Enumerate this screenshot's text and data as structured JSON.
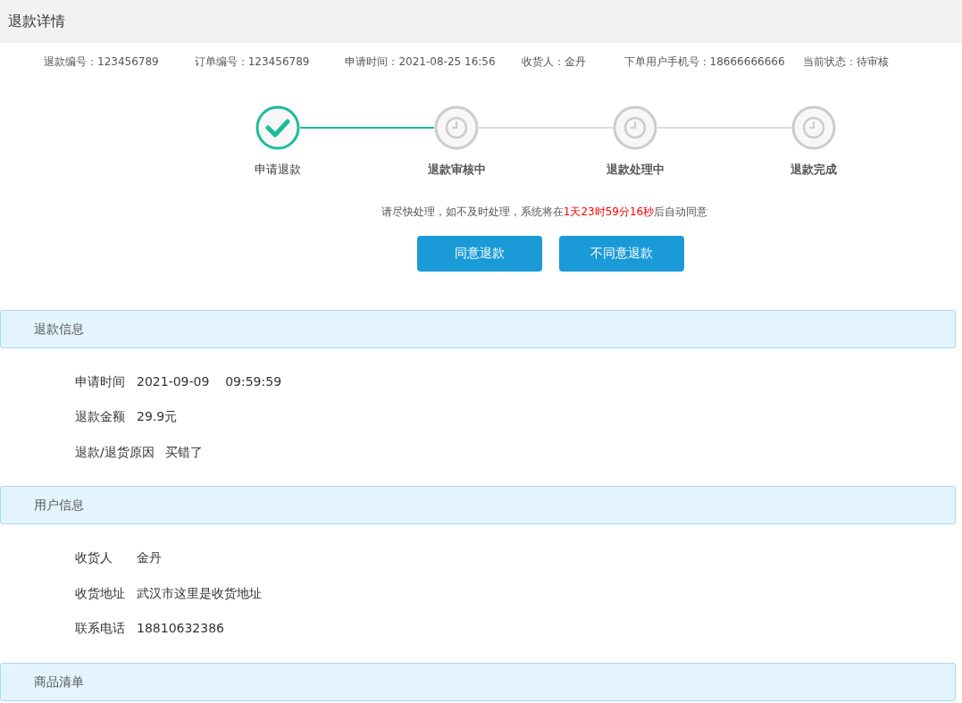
{
  "page_title": "退款详情",
  "summary": [
    {
      "label": "退款编号：",
      "value": "123456789"
    },
    {
      "label": "订单编号：",
      "value": "123456789"
    },
    {
      "label": "申请时间：",
      "value": "2021-08-25 16:56"
    },
    {
      "label": "收货人：",
      "value": "金丹"
    },
    {
      "label": "下单用户手机号：",
      "value": "18666666666"
    },
    {
      "label": "当前状态：",
      "value": "待审核"
    }
  ],
  "steps": [
    {
      "label": "申请退款",
      "done": true
    },
    {
      "label": "退款审核中",
      "done": false
    },
    {
      "label": "退款处理中",
      "done": false
    },
    {
      "label": "退款完成",
      "done": false
    }
  ],
  "notice": {
    "before": "请尽快处理，如不及时处理，系统将在",
    "countdown": "1天23时59分16秒",
    "after": "后自动同意"
  },
  "buttons": [
    "同意退款",
    "不同意退款"
  ],
  "sections": [
    {
      "title": "退款信息",
      "rows": [
        {
          "label": "申请时间",
          "value": "2021-09-09    09:59:59"
        },
        {
          "label": "退款金额",
          "value": "29.9元"
        },
        {
          "label": "退款/退货原因",
          "value": "买错了"
        }
      ]
    },
    {
      "title": "用户信息",
      "rows": [
        {
          "label": "收货人",
          "value": "金丹"
        },
        {
          "label": "收货地址",
          "value": "武汉市这里是收货地址"
        },
        {
          "label": "联系电话",
          "value": "18810632386"
        }
      ]
    },
    {
      "title": "商品清单"
    }
  ]
}
